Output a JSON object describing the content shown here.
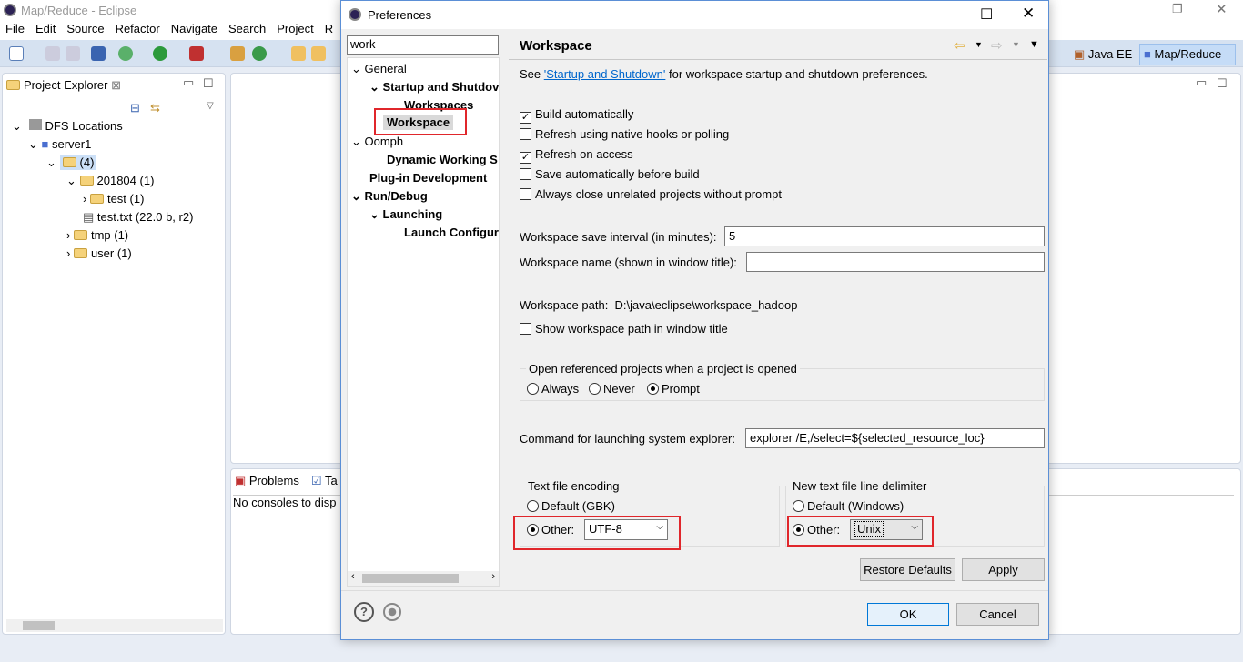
{
  "window": {
    "title": "Map/Reduce - Eclipse"
  },
  "menu": [
    "File",
    "Edit",
    "Source",
    "Refactor",
    "Navigate",
    "Search",
    "Project",
    "R"
  ],
  "perspectives": {
    "java_ee": "Java EE",
    "map_reduce": "Map/Reduce"
  },
  "project_explorer": {
    "title": "Project Explorer",
    "items": [
      {
        "label": "DFS Locations",
        "depth": 0
      },
      {
        "label": "server1",
        "depth": 1
      },
      {
        "label": "(4)",
        "depth": 2
      },
      {
        "label": "201804 (1)",
        "depth": 3
      },
      {
        "label": "test (1)",
        "depth": 4
      },
      {
        "label": "test.txt (22.0 b, r2)",
        "depth": 3
      },
      {
        "label": "tmp (1)",
        "depth": 3
      },
      {
        "label": "user (1)",
        "depth": 3
      }
    ]
  },
  "bottom_panel": {
    "tab_problems": "Problems",
    "tab_tasks": "Ta",
    "message": "No consoles to disp"
  },
  "dialog": {
    "title": "Preferences",
    "filter": "work",
    "tree": [
      {
        "label": "General",
        "depth": 0,
        "bold": false
      },
      {
        "label": "Startup and Shutdov",
        "depth": 1,
        "bold": true
      },
      {
        "label": "Workspaces",
        "depth": 2,
        "bold": true
      },
      {
        "label": "Workspace",
        "depth": 1,
        "bold": true,
        "selected": true
      },
      {
        "label": "Oomph",
        "depth": 0,
        "bold": false
      },
      {
        "label": "Dynamic Working S",
        "depth": 1,
        "bold": true
      },
      {
        "label": "Plug-in Development",
        "depth": 0,
        "bold": true
      },
      {
        "label": "Run/Debug",
        "depth": 0,
        "bold": true
      },
      {
        "label": "Launching",
        "depth": 1,
        "bold": true
      },
      {
        "label": "Launch Configura",
        "depth": 2,
        "bold": true
      }
    ],
    "page": {
      "title": "Workspace",
      "see_prefix": "See ",
      "see_link": "'Startup and Shutdown'",
      "see_suffix": " for workspace startup and shutdown preferences.",
      "checkboxes": [
        {
          "label": "Build automatically",
          "checked": true
        },
        {
          "label": "Refresh using native hooks or polling",
          "checked": false
        },
        {
          "label": "Refresh on access",
          "checked": true
        },
        {
          "label": "Save automatically before build",
          "checked": false
        },
        {
          "label": "Always close unrelated projects without prompt",
          "checked": false
        }
      ],
      "save_interval_label": "Workspace save interval (in minutes):",
      "save_interval_value": "5",
      "name_label": "Workspace name (shown in window title):",
      "name_value": "",
      "path_label": "Workspace path:",
      "path_value": "D:\\java\\eclipse\\workspace_hadoop",
      "show_path_label": "Show workspace path in window title",
      "show_path_checked": false,
      "open_group_label": "Open referenced projects when a project is opened",
      "open_options": [
        "Always",
        "Never",
        "Prompt"
      ],
      "open_selected": "Prompt",
      "explorer_label": "Command for launching system explorer:",
      "explorer_value": "explorer /E,/select=${selected_resource_loc}",
      "encoding_group": "Text file encoding",
      "encoding_default": "Default (GBK)",
      "encoding_other": "Other:",
      "encoding_value": "UTF-8",
      "delimiter_group": "New text file line delimiter",
      "delimiter_default": "Default (Windows)",
      "delimiter_other": "Other:",
      "delimiter_value": "Unix",
      "restore_defaults": "Restore Defaults",
      "apply": "Apply"
    },
    "ok": "OK",
    "cancel": "Cancel",
    "highlight_color": "#e0262b"
  }
}
